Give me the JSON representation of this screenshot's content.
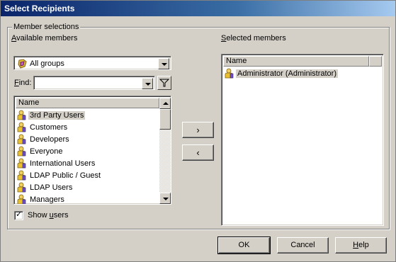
{
  "window": {
    "title": "Select Recipients",
    "close_glyph": "×"
  },
  "group": {
    "legend": "Member selections"
  },
  "available": {
    "label_accel": "A",
    "label_rest": "vailable members",
    "group_filter_value": "All groups",
    "find_label_accel": "F",
    "find_label_rest": "ind:",
    "find_value": "",
    "list_header": "Name",
    "items": [
      {
        "label": "3rd Party Users",
        "selected": true
      },
      {
        "label": "Customers",
        "selected": false
      },
      {
        "label": "Developers",
        "selected": false
      },
      {
        "label": "Everyone",
        "selected": false
      },
      {
        "label": "International Users",
        "selected": false
      },
      {
        "label": "LDAP Public / Guest",
        "selected": false
      },
      {
        "label": "LDAP Users",
        "selected": false
      },
      {
        "label": "Managers",
        "selected": false
      }
    ],
    "show_users_pre": "Show ",
    "show_users_accel": "u",
    "show_users_rest": "sers",
    "show_users_checked": true
  },
  "selected": {
    "label_accel": "S",
    "label_rest": "elected members",
    "list_header": "Name",
    "items": [
      {
        "label": "Administrator (Administrator)",
        "selected": true
      }
    ]
  },
  "buttons": {
    "add": "›",
    "remove": "‹",
    "ok": "OK",
    "cancel": "Cancel",
    "help_accel": "H",
    "help_rest": "elp"
  },
  "icons": {
    "group": "group-icon",
    "user": "user-icon",
    "filter": "filter-icon",
    "dropdown": "chevron-down-icon"
  }
}
